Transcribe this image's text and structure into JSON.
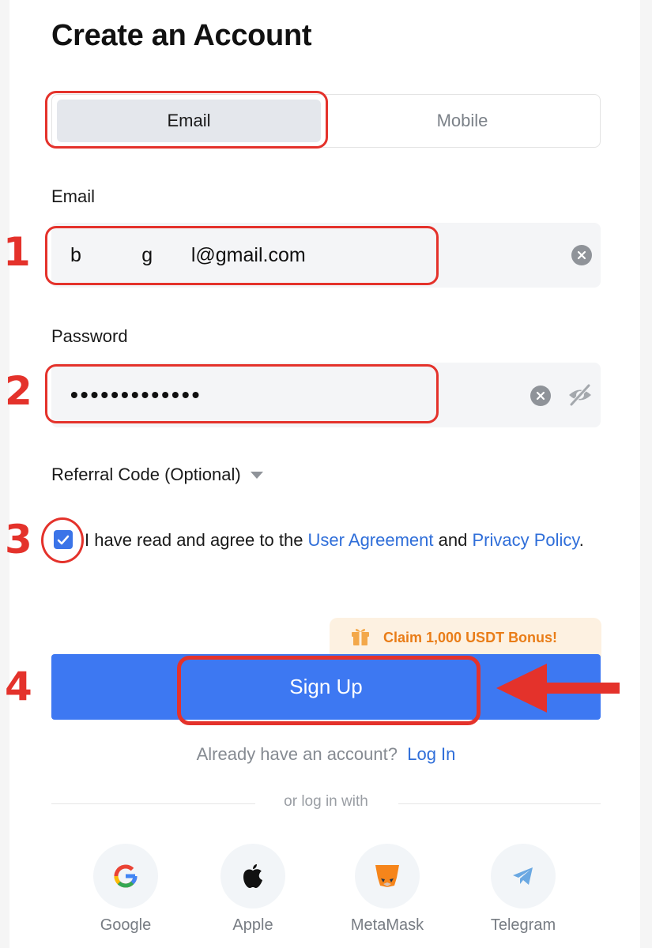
{
  "title": "Create an Account",
  "tabs": {
    "email": "Email",
    "mobile": "Mobile"
  },
  "email": {
    "label": "Email",
    "value": "b           g       l@gmail.com"
  },
  "password": {
    "label": "Password",
    "value": "•••••••••••••"
  },
  "referral": {
    "label": "Referral Code (Optional)"
  },
  "agreement": {
    "prefix": "I have read and agree to the ",
    "user_agreement": "User Agreement",
    "and": " and ",
    "privacy_policy": "Privacy Policy",
    "suffix": ".",
    "checked": true
  },
  "bonus": {
    "text": "Claim 1,000 USDT Bonus!"
  },
  "signup": {
    "label": "Sign Up"
  },
  "login_prompt": {
    "text": "Already have an account?",
    "link": "Log In"
  },
  "divider": {
    "text": "or log in with"
  },
  "social": [
    {
      "label": "Google",
      "icon": "google-icon"
    },
    {
      "label": "Apple",
      "icon": "apple-icon"
    },
    {
      "label": "MetaMask",
      "icon": "metamask-icon"
    },
    {
      "label": "Telegram",
      "icon": "telegram-icon"
    }
  ],
  "annotations": {
    "step1": "1",
    "step2": "2",
    "step3": "3",
    "step4": "4"
  },
  "colors": {
    "accent": "#3d78f2",
    "link": "#2f6ed9",
    "annotation": "#e4322b",
    "bonus": "#e97d18"
  }
}
